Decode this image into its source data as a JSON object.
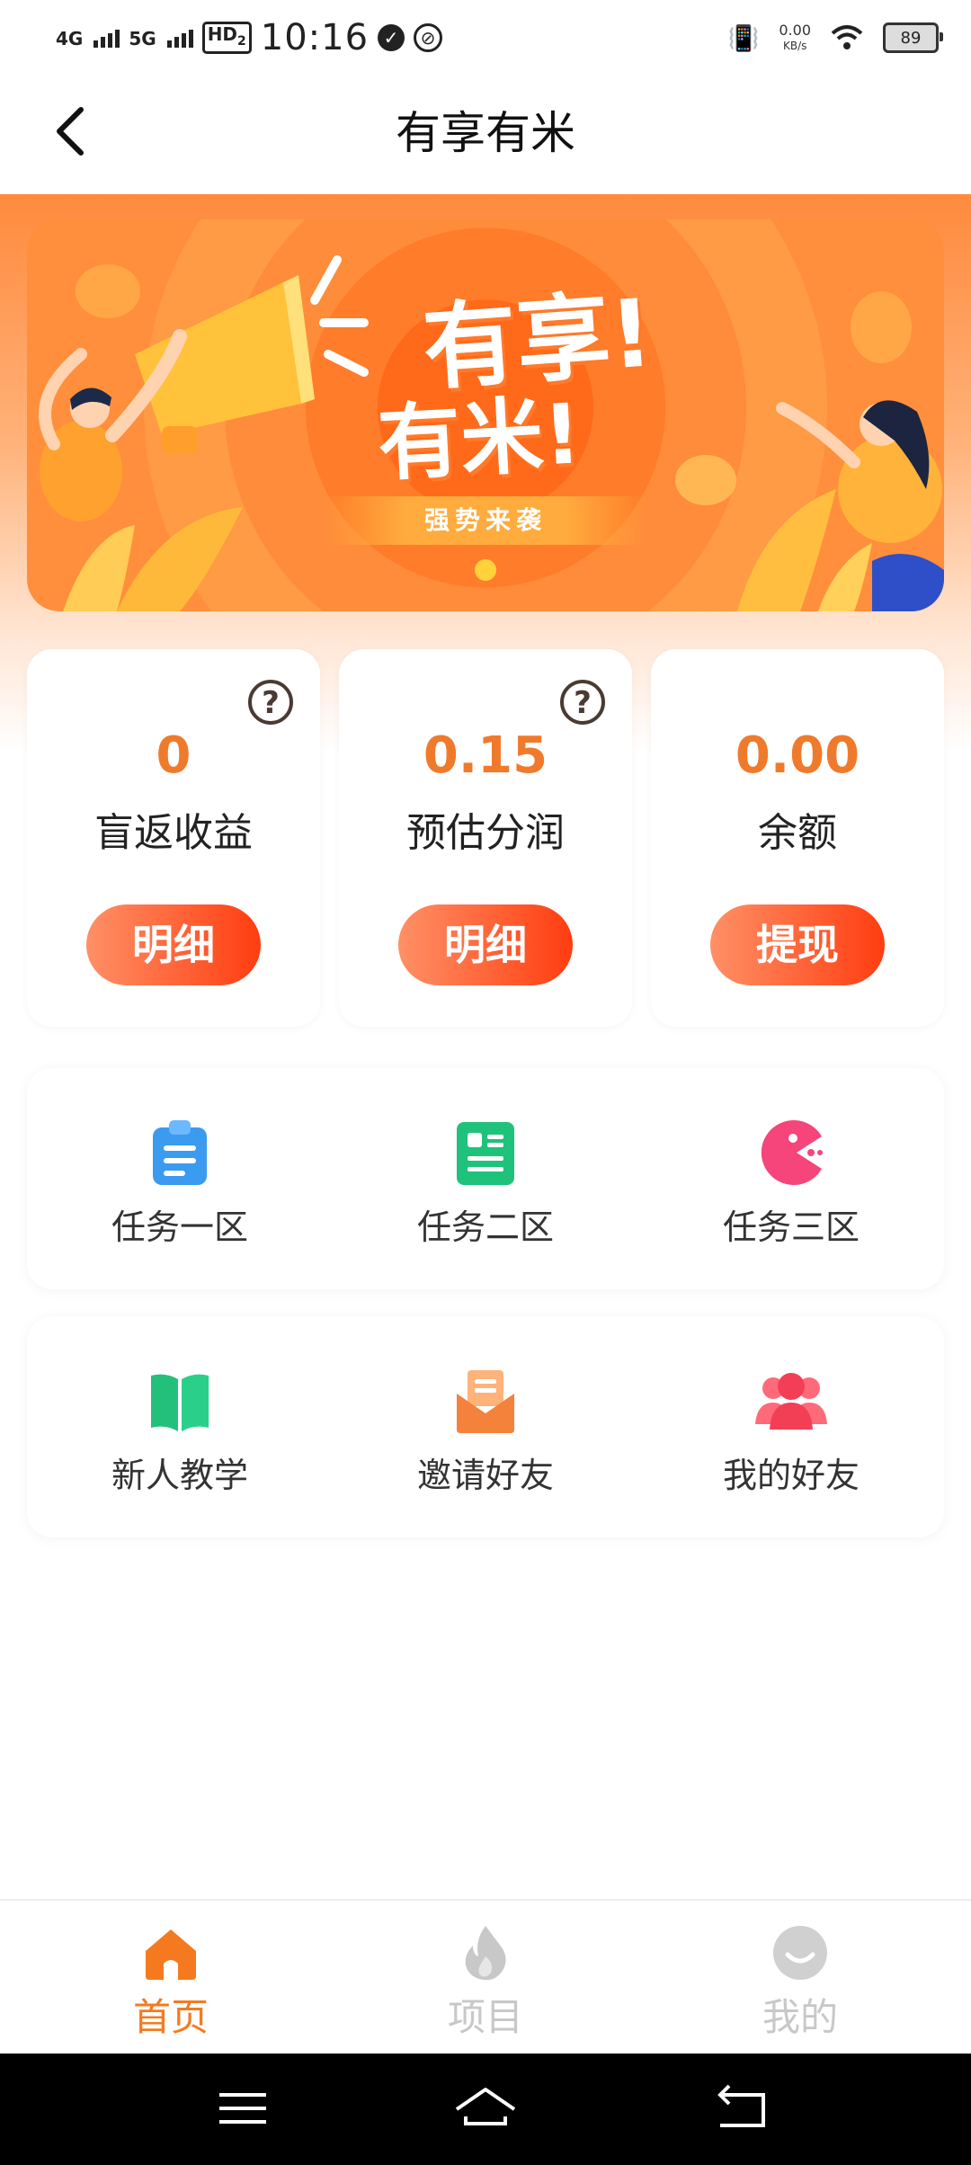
{
  "status_bar": {
    "sig1": "4G",
    "sig2": "5G",
    "hd": "HD",
    "hd_sub": "2",
    "time": "10:16",
    "net_speed": "0.00",
    "net_unit": "KB/s",
    "battery": "89"
  },
  "header": {
    "title": "有享有米"
  },
  "banner": {
    "line1": "有享!",
    "line2": "有米!",
    "ribbon": "强势来袭"
  },
  "stats": [
    {
      "value": "0",
      "label": "盲返收益",
      "button": "明细"
    },
    {
      "value": "0.15",
      "label": "预估分润",
      "button": "明细"
    },
    {
      "value": "0.00",
      "label": "余额",
      "button": "提现"
    }
  ],
  "tasks": [
    {
      "label": "任务一区",
      "icon": "clipboard-icon"
    },
    {
      "label": "任务二区",
      "icon": "document-icon"
    },
    {
      "label": "任务三区",
      "icon": "pacman-icon"
    }
  ],
  "tools": [
    {
      "label": "新人教学",
      "icon": "book-icon"
    },
    {
      "label": "邀请好友",
      "icon": "envelope-icon"
    },
    {
      "label": "我的好友",
      "icon": "users-icon"
    }
  ],
  "tabbar": {
    "items": [
      {
        "label": "首页",
        "active": true
      },
      {
        "label": "项目",
        "active": false
      },
      {
        "label": "我的",
        "active": false
      }
    ]
  },
  "colors": {
    "accent": "#f07a2c",
    "button_gradient_start": "#ff9066",
    "button_gradient_end": "#ff3d10",
    "tab_active": "#f57a1f",
    "tab_inactive": "#c8c8c8"
  }
}
